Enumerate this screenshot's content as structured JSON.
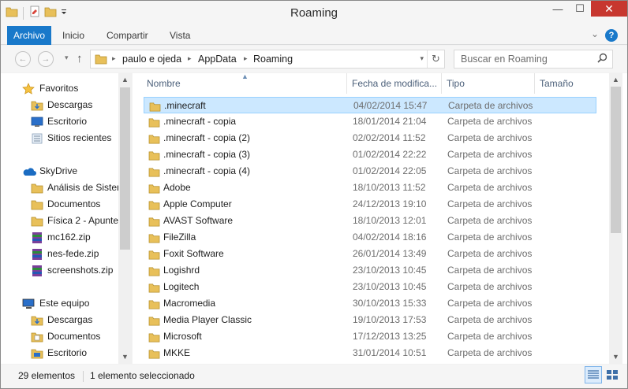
{
  "window": {
    "title": "Roaming",
    "minimize_glyph": "—",
    "maximize_glyph": "☐",
    "close_glyph": "✕"
  },
  "ribbon": {
    "tabs": [
      "Archivo",
      "Inicio",
      "Compartir",
      "Vista"
    ],
    "help_glyph": "?",
    "expand_glyph": "⌄"
  },
  "navigation": {
    "back_glyph": "←",
    "forward_glyph": "→",
    "up_glyph": "↑",
    "breadcrumb": [
      "paulo e ojeda",
      "AppData",
      "Roaming"
    ],
    "search_placeholder": "Buscar en Roaming"
  },
  "nav_pane": {
    "items": [
      {
        "label": "Favoritos",
        "icon": "star-icon",
        "level": 0
      },
      {
        "label": "Descargas",
        "icon": "downloads-folder-icon",
        "level": 1
      },
      {
        "label": "Escritorio",
        "icon": "desktop-icon",
        "level": 1
      },
      {
        "label": "Sitios recientes",
        "icon": "recent-places-icon",
        "level": 1
      },
      {
        "label": "SkyDrive",
        "icon": "skydrive-cloud-icon",
        "level": 0
      },
      {
        "label": "Análisis de Sisten",
        "icon": "folder-icon",
        "level": 1
      },
      {
        "label": "Documentos",
        "icon": "folder-icon",
        "level": 1
      },
      {
        "label": "Física 2 - Apunte",
        "icon": "folder-icon",
        "level": 1
      },
      {
        "label": "mc162.zip",
        "icon": "zip-archive-icon",
        "level": 1
      },
      {
        "label": "nes-fede.zip",
        "icon": "zip-archive-icon",
        "level": 1
      },
      {
        "label": "screenshots.zip",
        "icon": "zip-archive-icon",
        "level": 1
      },
      {
        "label": "Este equipo",
        "icon": "computer-icon",
        "level": 0
      },
      {
        "label": "Descargas",
        "icon": "downloads-folder-icon",
        "level": 1
      },
      {
        "label": "Documentos",
        "icon": "documents-folder-icon",
        "level": 1
      },
      {
        "label": "Escritorio",
        "icon": "desktop-folder-icon",
        "level": 1
      }
    ]
  },
  "file_list": {
    "columns": [
      "Nombre",
      "Fecha de modifica...",
      "Tipo",
      "Tamaño"
    ],
    "rows": [
      {
        "name": ".minecraft",
        "date": "04/02/2014 15:47",
        "type": "Carpeta de archivos",
        "selected": true
      },
      {
        "name": ".minecraft - copia",
        "date": "18/01/2014 21:04",
        "type": "Carpeta de archivos",
        "selected": false
      },
      {
        "name": ".minecraft - copia (2)",
        "date": "02/02/2014 11:52",
        "type": "Carpeta de archivos",
        "selected": false
      },
      {
        "name": ".minecraft - copia (3)",
        "date": "01/02/2014 22:22",
        "type": "Carpeta de archivos",
        "selected": false
      },
      {
        "name": ".minecraft - copia (4)",
        "date": "01/02/2014 22:05",
        "type": "Carpeta de archivos",
        "selected": false
      },
      {
        "name": "Adobe",
        "date": "18/10/2013 11:52",
        "type": "Carpeta de archivos",
        "selected": false
      },
      {
        "name": "Apple Computer",
        "date": "24/12/2013 19:10",
        "type": "Carpeta de archivos",
        "selected": false
      },
      {
        "name": "AVAST Software",
        "date": "18/10/2013 12:01",
        "type": "Carpeta de archivos",
        "selected": false
      },
      {
        "name": "FileZilla",
        "date": "04/02/2014 18:16",
        "type": "Carpeta de archivos",
        "selected": false
      },
      {
        "name": "Foxit Software",
        "date": "26/01/2014 13:49",
        "type": "Carpeta de archivos",
        "selected": false
      },
      {
        "name": "Logishrd",
        "date": "23/10/2013 10:45",
        "type": "Carpeta de archivos",
        "selected": false
      },
      {
        "name": "Logitech",
        "date": "23/10/2013 10:45",
        "type": "Carpeta de archivos",
        "selected": false
      },
      {
        "name": "Macromedia",
        "date": "30/10/2013 15:33",
        "type": "Carpeta de archivos",
        "selected": false
      },
      {
        "name": "Media Player Classic",
        "date": "19/10/2013 17:53",
        "type": "Carpeta de archivos",
        "selected": false
      },
      {
        "name": "Microsoft",
        "date": "17/12/2013 13:25",
        "type": "Carpeta de archivos",
        "selected": false
      },
      {
        "name": "MKKE",
        "date": "31/01/2014 10:51",
        "type": "Carpeta de archivos",
        "selected": false
      }
    ]
  },
  "status_bar": {
    "item_count": "29 elementos",
    "selection": "1 elemento seleccionado"
  },
  "colors": {
    "accent": "#1979ca",
    "selection_bg": "#cce8ff",
    "selection_border": "#99d1ff",
    "close_button": "#c7372f",
    "folder": "#e8c05a"
  }
}
